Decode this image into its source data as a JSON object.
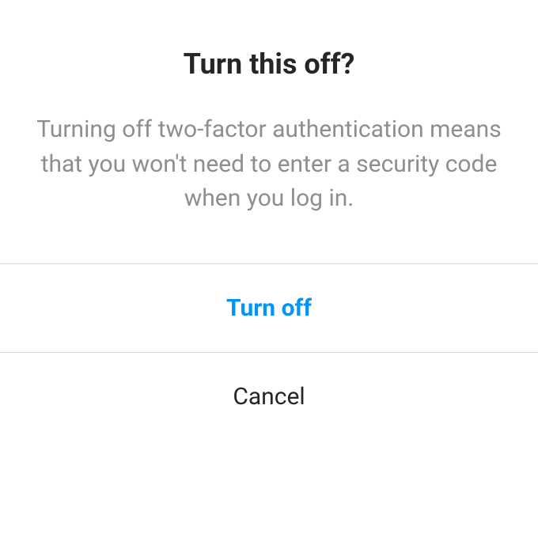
{
  "dialog": {
    "title": "Turn this off?",
    "body": "Turning off two-factor authentica­tion means that you won't need to enter a security code when you log in.",
    "primary_action_label": "Turn off",
    "secondary_action_label": "Cancel"
  },
  "colors": {
    "accent": "#0095f6",
    "text_primary": "#262626",
    "text_secondary": "#8e8e8e",
    "divider": "#dbdbdb"
  }
}
